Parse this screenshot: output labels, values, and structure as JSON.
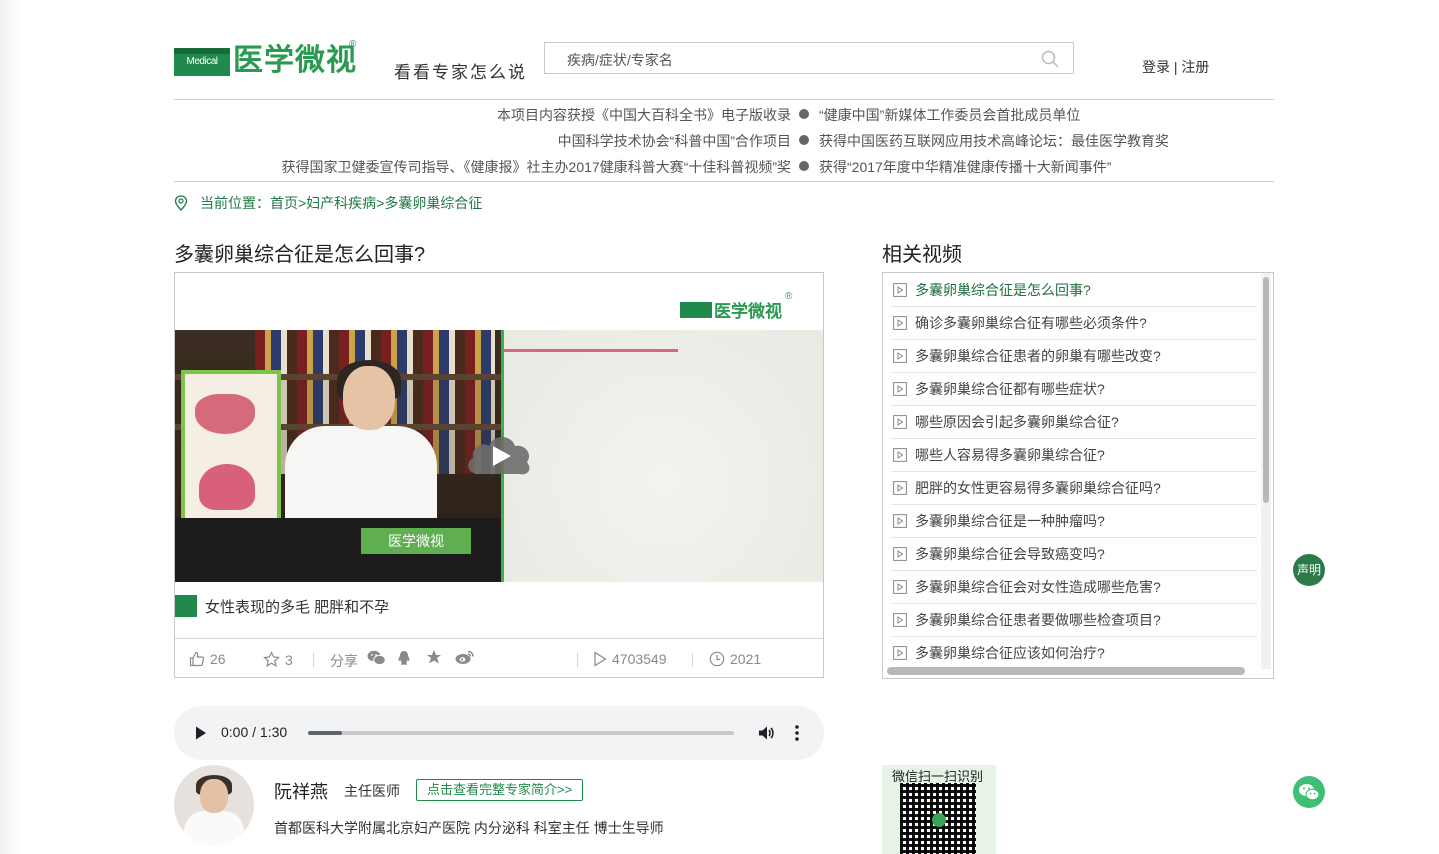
{
  "header": {
    "logo_box_text": "Medical Video",
    "logo_text": "医学微视",
    "logo_reg": "®",
    "slogan": "看看专家怎么说",
    "search_placeholder": "疾病/症状/专家名",
    "login": "登录",
    "separator": " | ",
    "register": "注册"
  },
  "honors": {
    "left": [
      "本项目内容获授《中国大百科全书》电子版收录",
      "中国科学技术协会“科普中国”合作项目",
      "获得国家卫健委宣传司指导、《健康报》社主办2017健康科普大赛“十佳科普视频”奖"
    ],
    "right": [
      "“健康中国”新媒体工作委员会首批成员单位",
      "获得中国医药互联网应用技术高峰论坛：最佳医学教育奖",
      "获得“2017年度中华精准健康传播十大新闻事件”"
    ]
  },
  "breadcrumb": {
    "prefix": "当前位置：",
    "home": "首页",
    "sep": ">",
    "category": "妇产科疾病",
    "current": "多囊卵巢综合征"
  },
  "video": {
    "title": "多囊卵巢综合征是怎么回事?",
    "player_logo": "医学微视",
    "nameplate": "医学微视",
    "subtitle": "女性表现的多毛 肥胖和不孕",
    "likes": "26",
    "favorites": "3",
    "share_label": "分享",
    "views": "4703549",
    "year": "2021"
  },
  "related": {
    "title": "相关视频",
    "items": [
      "多囊卵巢综合征是怎么回事?",
      "确诊多囊卵巢综合征有哪些必须条件?",
      "多囊卵巢综合征患者的卵巢有哪些改变?",
      "多囊卵巢综合征都有哪些症状?",
      "哪些原因会引起多囊卵巢综合征?",
      "哪些人容易得多囊卵巢综合征?",
      "肥胖的女性更容易得多囊卵巢综合征吗?",
      "多囊卵巢综合征是一种肿瘤吗?",
      "多囊卵巢综合征会导致癌变吗?",
      "多囊卵巢综合征会对女性造成哪些危害?",
      "多囊卵巢综合征患者要做哪些检查项目?",
      "多囊卵巢综合征应该如何治疗?"
    ]
  },
  "audio": {
    "time": "0:00 / 1:30",
    "progress_fraction": 0.08
  },
  "doctor": {
    "name": "阮祥燕",
    "title": "主任医师",
    "profile_button": "点击查看完整专家简介>>",
    "org": "首都医科大学附属北京妇产医院 内分泌科 科室主任 博士生导师"
  },
  "side": {
    "statement": "声明"
  },
  "qr": {
    "label": "微信扫一扫识别"
  },
  "colors": {
    "brand_green": "#1f8a4c",
    "link_green": "#1f7a45"
  }
}
